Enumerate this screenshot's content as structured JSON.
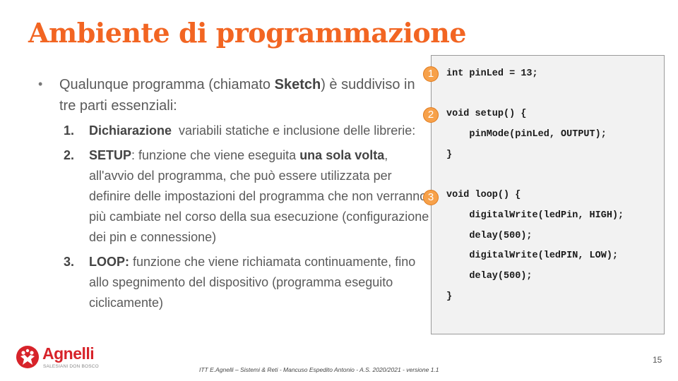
{
  "title": "Ambiente di programmazione",
  "bullet": {
    "pre": "Qualunque programma (chiamato ",
    "bold": "Sketch",
    "post": ") è suddiviso in tre parti essenziali:"
  },
  "items": [
    {
      "num": "1.",
      "bold": "Dichiarazione",
      "text": "  variabili statiche e inclusione delle librerie:"
    },
    {
      "num": "2.",
      "bold": "SETUP",
      "text": ": funzione che viene eseguita ",
      "bold2": "una sola volta",
      "text2": ", all'avvio del programma, che può essere utilizzata per definire delle impostazioni del programma che non verranno più cambiate nel corso della sua esecuzione (configurazione dei pin e connessione)"
    },
    {
      "num": "3.",
      "bold": "LOOP:",
      "text": " funzione che viene richiamata continuamente, fino allo spegnimento del dispositivo (programma eseguito ciclicamente)"
    }
  ],
  "code": {
    "lines": [
      "int pinLed = 13;",
      "",
      "void setup() {",
      "    pinMode(pinLed, OUTPUT);",
      "}",
      "",
      "void loop() {",
      "    digitalWrite(ledPin, HIGH);",
      "    delay(500);",
      "    digitalWrite(ledPIN, LOW);",
      "    delay(500);",
      "}"
    ],
    "markers": [
      "1",
      "2",
      "3"
    ]
  },
  "page_number": "15",
  "footer": "ITT E.Agnelli – Sistemi & Reti - Mancuso Espedito Antonio - A.S. 2020/2021 - versione 1.1",
  "logo": {
    "name": "Agnelli",
    "sub": "SALESIANI DON BOSCO"
  },
  "colors": {
    "accent": "#f26522",
    "marker": "#f7a14a",
    "logo": "#d7232a"
  }
}
